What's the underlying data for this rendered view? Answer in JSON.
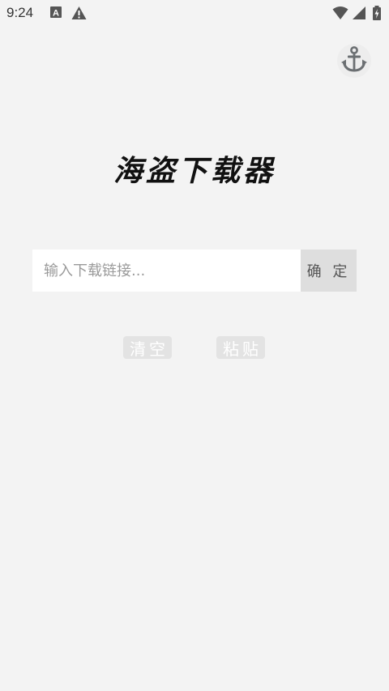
{
  "status_bar": {
    "time": "9:24",
    "icons": [
      "text-notification-icon",
      "warning-icon",
      "wifi-icon",
      "signal-icon",
      "battery-icon"
    ]
  },
  "header": {
    "action_icon": "anchor-icon"
  },
  "app": {
    "title": "海盗下载器"
  },
  "download_form": {
    "input_value": "",
    "input_placeholder": "输入下载链接...",
    "confirm_label": "确 定"
  },
  "actions": {
    "clear_label": "清空",
    "paste_label": "粘贴"
  },
  "colors": {
    "background": "#f3f3f3",
    "button_gray": "#dedede",
    "text_dark": "#111111"
  }
}
